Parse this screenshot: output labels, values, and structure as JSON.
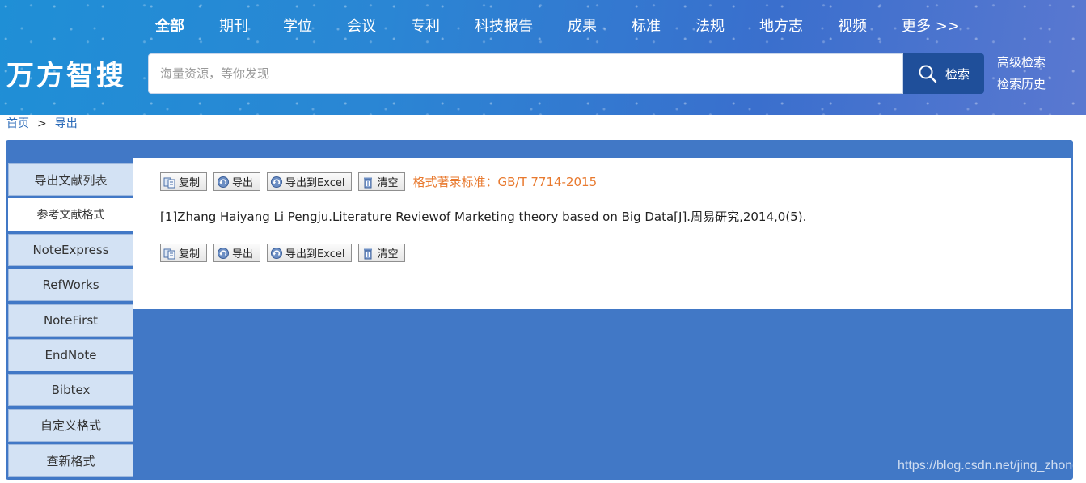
{
  "header": {
    "nav": [
      {
        "label": "全部",
        "active": true
      },
      {
        "label": "期刊"
      },
      {
        "label": "学位"
      },
      {
        "label": "会议"
      },
      {
        "label": "专利"
      },
      {
        "label": "科技报告"
      },
      {
        "label": "成果"
      },
      {
        "label": "标准"
      },
      {
        "label": "法规"
      },
      {
        "label": "地方志"
      },
      {
        "label": "视频"
      },
      {
        "label": "更多 >>"
      }
    ],
    "logo": "万方智搜",
    "search": {
      "placeholder": "海量资源，等你发现",
      "value": "",
      "button_label": "检索",
      "button_icon": "search-icon"
    },
    "links": {
      "advanced": "高级检索",
      "history": "检索历史"
    }
  },
  "breadcrumb": {
    "home": "首页",
    "separator": ">",
    "current": "导出"
  },
  "sidebar": {
    "tabs": [
      {
        "label": "导出文献列表"
      },
      {
        "label": "参考文献格式",
        "active": true
      },
      {
        "label": "NoteExpress"
      },
      {
        "label": "RefWorks"
      },
      {
        "label": "NoteFirst"
      },
      {
        "label": "EndNote"
      },
      {
        "label": "Bibtex"
      },
      {
        "label": "自定义格式"
      },
      {
        "label": "查新格式"
      }
    ]
  },
  "toolbar": {
    "copy": "复制",
    "export": "导出",
    "export_excel": "导出到Excel",
    "clear": "清空",
    "format_standard": "格式著录标准：GB/T 7714-2015"
  },
  "citation": "[1]Zhang Haiyang Li Pengju.Literature Reviewof Marketing theory based on Big Data[J].周易研究,2014,0(5).",
  "watermark": "https://blog.csdn.net/jing_zhong",
  "colors": {
    "panel": "#4178c6",
    "search_button": "#1f4f9a",
    "format_note": "#e8792e",
    "tab_bg": "#d3e2f4"
  }
}
